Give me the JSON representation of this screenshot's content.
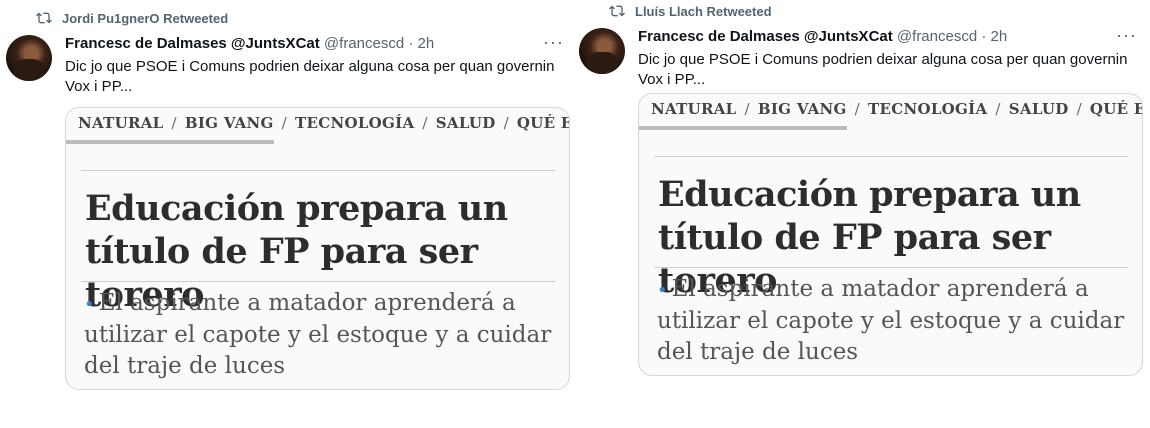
{
  "tweets": [
    {
      "retweeted_by": "Jordi Pu1gnerO Retweeted",
      "author_name": "Francesc de Dalmases @JuntsXCat",
      "author_handle": "@francescd · 2h",
      "text": "Dic jo que PSOE i Comuns podrien deixar alguna cosa per quan governin Vox i PP...",
      "card": {
        "nav": [
          "NATURAL",
          "BIG VANG",
          "TECNOLOGÍA",
          "SALUD",
          "QUÉ ESTU"
        ],
        "headline": "Educación prepara un título de FP para ser torero",
        "subhead": "El aspirante a matador aprenderá a utilizar el capote y el estoque y a cuidar del traje de luces"
      }
    },
    {
      "retweeted_by": "Lluís Llach Retweeted",
      "author_name": "Francesc de Dalmases @JuntsXCat",
      "author_handle": "@francescd · 2h",
      "text": "Dic jo que PSOE i Comuns podrien deixar alguna cosa per quan governin Vox i PP...",
      "card": {
        "nav": [
          "NATURAL",
          "BIG VANG",
          "TECNOLOGÍA",
          "SALUD",
          "QUÉ ESTU"
        ],
        "headline": "Educación prepara un título de FP para ser torero",
        "subhead": "El aspirante a matador aprenderá a utilizar el capote y el estoque y a cuidar del traje de luces"
      }
    }
  ],
  "icons": {
    "retweet": "retweet-icon",
    "more": "more-options-icon"
  },
  "colors": {
    "muted": "#536471",
    "bullet": "#3b7fc4",
    "border": "#cfd9de"
  }
}
